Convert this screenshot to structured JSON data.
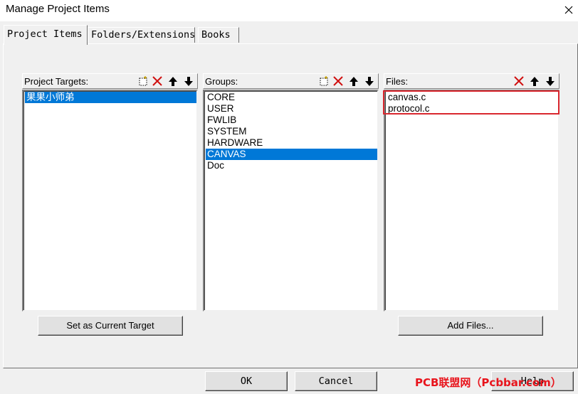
{
  "window": {
    "title": "Manage Project Items",
    "close_icon": "close-icon"
  },
  "tabs": [
    {
      "label": "Project Items",
      "active": true
    },
    {
      "label": "Folders/Extensions",
      "active": false
    },
    {
      "label": "Books",
      "active": false
    }
  ],
  "targets": {
    "label": "Project Targets:",
    "toolbar": [
      "new-icon",
      "delete-icon",
      "move-up-icon",
      "move-down-icon"
    ],
    "items": [
      {
        "text": "果果小师弟",
        "selected": true
      }
    ],
    "button": "Set as Current Target"
  },
  "groups": {
    "label": "Groups:",
    "toolbar": [
      "new-icon",
      "delete-icon",
      "move-up-icon",
      "move-down-icon"
    ],
    "items": [
      {
        "text": "CORE",
        "selected": false
      },
      {
        "text": "USER",
        "selected": false
      },
      {
        "text": "FWLIB",
        "selected": false
      },
      {
        "text": "SYSTEM",
        "selected": false
      },
      {
        "text": "HARDWARE",
        "selected": false
      },
      {
        "text": "CANVAS",
        "selected": true
      },
      {
        "text": "Doc",
        "selected": false
      }
    ]
  },
  "files": {
    "label": "Files:",
    "toolbar": [
      "delete-icon",
      "move-up-icon",
      "move-down-icon"
    ],
    "items": [
      {
        "text": "canvas.c",
        "selected": false
      },
      {
        "text": "protocol.c",
        "selected": false
      }
    ],
    "button": "Add Files..."
  },
  "footer": {
    "ok": "OK",
    "cancel": "Cancel",
    "help": "Help"
  },
  "watermark": "PCB联盟网（Pcbbar.com）",
  "colors": {
    "selection": "#0078d7",
    "highlight_box": "#d9272e",
    "watermark": "#e8141c",
    "dialog_bg": "#f0f0f0"
  }
}
